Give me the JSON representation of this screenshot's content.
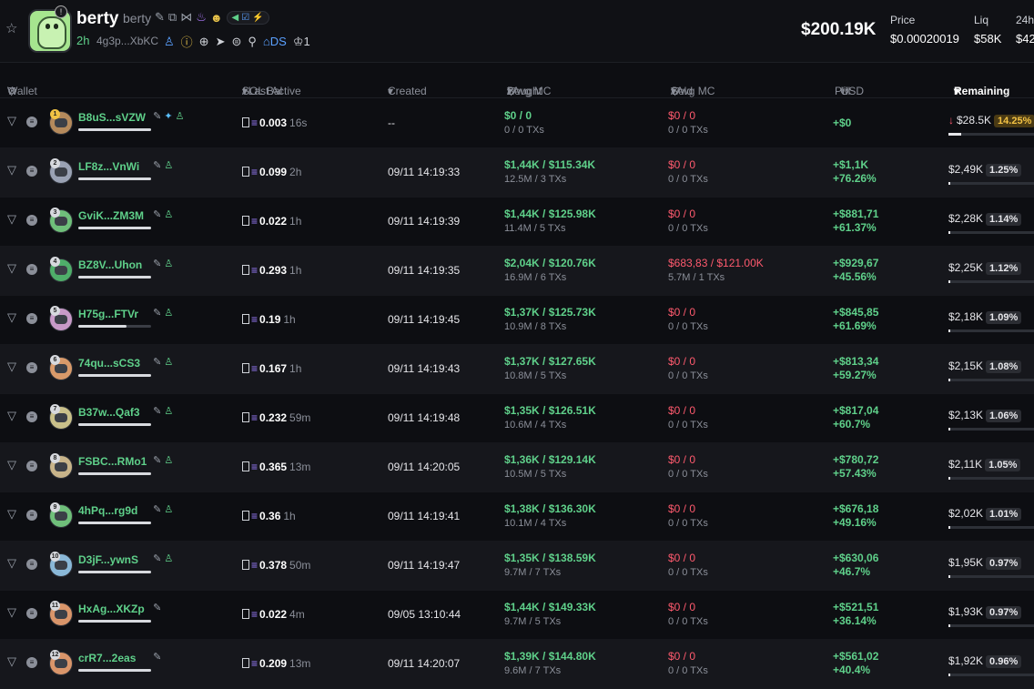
{
  "header": {
    "token_name": "berty",
    "token_symbol": "berty",
    "age": "2h",
    "address": "4g3p...XbKC",
    "market_cap": "$200.19K",
    "stats": [
      {
        "label": "Price",
        "value": "$0.00020019"
      },
      {
        "label": "Liq",
        "value": "$58K"
      },
      {
        "label": "24h",
        "value": "$42"
      }
    ],
    "ds_label": "DS",
    "holders_count": "1"
  },
  "columns": {
    "wallet": "Wallet",
    "sol_bal": "SOL Bal",
    "last_active": "/ Last Active",
    "created": "Created",
    "bought": "Bought",
    "avg_mc_bought": "/ Avg MC",
    "sold": "Sold",
    "avg_mc_sold": "/ Avg MC",
    "pnl": "Pnl",
    "usd": "USD",
    "remaining": "Remaining"
  },
  "rows": [
    {
      "rank": "1",
      "wallet": "B8uS...sVZW",
      "sol": "0.003",
      "ago": "16s",
      "created": "--",
      "bought": "$0 / 0",
      "bought_sub": "0 / 0 TXs",
      "sold": "$0 / 0",
      "sold_sub": "0 / 0 TXs",
      "pnl": "+$0",
      "pnl_pct": "",
      "remaining": "$28.5K",
      "rem_pct": "14.25%",
      "rem_down": "↓",
      "bar": 0.15,
      "color": "#b58a5c"
    },
    {
      "rank": "2",
      "wallet": "LF8z...VnWi",
      "sol": "0.099",
      "ago": "2h",
      "created": "09/11 14:19:33",
      "bought": "$1,44K / $115.34K",
      "bought_sub": "12.5M / 3 TXs",
      "sold": "$0 / 0",
      "sold_sub": "0 / 0 TXs",
      "pnl": "+$1,1K",
      "pnl_pct": "+76.26%",
      "remaining": "$2,49K",
      "rem_pct": "1.25%",
      "rem_down": "",
      "bar": 0.02,
      "color": "#9aa2b4"
    },
    {
      "rank": "3",
      "wallet": "GviK...ZM3M",
      "sol": "0.022",
      "ago": "1h",
      "created": "09/11 14:19:39",
      "bought": "$1,44K / $125.98K",
      "bought_sub": "11.4M / 5 TXs",
      "sold": "$0 / 0",
      "sold_sub": "0 / 0 TXs",
      "pnl": "+$881,71",
      "pnl_pct": "+61.37%",
      "remaining": "$2,28K",
      "rem_pct": "1.14%",
      "rem_down": "",
      "bar": 0.02,
      "color": "#6fbf7a"
    },
    {
      "rank": "4",
      "wallet": "BZ8V...Uhon",
      "sol": "0.293",
      "ago": "1h",
      "created": "09/11 14:19:35",
      "bought": "$2,04K / $120.76K",
      "bought_sub": "16.9M / 6 TXs",
      "sold": "$683,83 / $121.00K",
      "sold_sub": "5.7M / 1 TXs",
      "pnl": "+$929,67",
      "pnl_pct": "+45.56%",
      "remaining": "$2,25K",
      "rem_pct": "1.12%",
      "rem_down": "",
      "bar": 0.02,
      "color": "#4fae6a"
    },
    {
      "rank": "5",
      "wallet": "H75g...FTVr",
      "sol": "0.19",
      "ago": "1h",
      "created": "09/11 14:19:45",
      "bought": "$1,37K / $125.73K",
      "bought_sub": "10.9M / 8 TXs",
      "sold": "$0 / 0",
      "sold_sub": "0 / 0 TXs",
      "pnl": "+$845,85",
      "pnl_pct": "+61.69%",
      "remaining": "$2,18K",
      "rem_pct": "1.09%",
      "rem_down": "",
      "bar": 0.02,
      "color": "#c89ac8"
    },
    {
      "rank": "6",
      "wallet": "74qu...sCS3",
      "sol": "0.167",
      "ago": "1h",
      "created": "09/11 14:19:43",
      "bought": "$1,37K / $127.65K",
      "bought_sub": "10.8M / 5 TXs",
      "sold": "$0 / 0",
      "sold_sub": "0 / 0 TXs",
      "pnl": "+$813,34",
      "pnl_pct": "+59.27%",
      "remaining": "$2,15K",
      "rem_pct": "1.08%",
      "rem_down": "",
      "bar": 0.02,
      "color": "#d99a6a"
    },
    {
      "rank": "7",
      "wallet": "B37w...Qaf3",
      "sol": "0.232",
      "ago": "59m",
      "created": "09/11 14:19:48",
      "bought": "$1,35K / $126.51K",
      "bought_sub": "10.6M / 4 TXs",
      "sold": "$0 / 0",
      "sold_sub": "0 / 0 TXs",
      "pnl": "+$817,04",
      "pnl_pct": "+60.7%",
      "remaining": "$2,13K",
      "rem_pct": "1.06%",
      "rem_down": "",
      "bar": 0.02,
      "color": "#c9c08a"
    },
    {
      "rank": "8",
      "wallet": "FSBC...RMo1",
      "sol": "0.365",
      "ago": "13m",
      "created": "09/11 14:20:05",
      "bought": "$1,36K / $129.14K",
      "bought_sub": "10.5M / 5 TXs",
      "sold": "$0 / 0",
      "sold_sub": "0 / 0 TXs",
      "pnl": "+$780,72",
      "pnl_pct": "+57.43%",
      "remaining": "$2,11K",
      "rem_pct": "1.05%",
      "rem_down": "",
      "bar": 0.02,
      "color": "#c8b48a"
    },
    {
      "rank": "9",
      "wallet": "4hPq...rg9d",
      "sol": "0.36",
      "ago": "1h",
      "created": "09/11 14:19:41",
      "bought": "$1,38K / $136.30K",
      "bought_sub": "10.1M / 4 TXs",
      "sold": "$0 / 0",
      "sold_sub": "0 / 0 TXs",
      "pnl": "+$676,18",
      "pnl_pct": "+49.16%",
      "remaining": "$2,02K",
      "rem_pct": "1.01%",
      "rem_down": "",
      "bar": 0.02,
      "color": "#6fbf7a"
    },
    {
      "rank": "10",
      "wallet": "D3jF...ywnS",
      "sol": "0.378",
      "ago": "50m",
      "created": "09/11 14:19:47",
      "bought": "$1,35K / $138.59K",
      "bought_sub": "9.7M / 7 TXs",
      "sold": "$0 / 0",
      "sold_sub": "0 / 0 TXs",
      "pnl": "+$630,06",
      "pnl_pct": "+46.7%",
      "remaining": "$1,95K",
      "rem_pct": "0.97%",
      "rem_down": "",
      "bar": 0.02,
      "color": "#8ab8d8"
    },
    {
      "rank": "11",
      "wallet": "HxAg...XKZp",
      "sol": "0.022",
      "ago": "4m",
      "created": "09/05 13:10:44",
      "bought": "$1,44K / $149.33K",
      "bought_sub": "9.7M / 5 TXs",
      "sold": "$0 / 0",
      "sold_sub": "0 / 0 TXs",
      "pnl": "+$521,51",
      "pnl_pct": "+36.14%",
      "remaining": "$1,93K",
      "rem_pct": "0.97%",
      "rem_down": "",
      "bar": 0.02,
      "color": "#d9956a"
    },
    {
      "rank": "12",
      "wallet": "crR7...2eas",
      "sol": "0.209",
      "ago": "13m",
      "created": "09/11 14:20:07",
      "bought": "$1,39K / $144.80K",
      "bought_sub": "9.6M / 7 TXs",
      "sold": "$0 / 0",
      "sold_sub": "0 / 0 TXs",
      "pnl": "+$561,02",
      "pnl_pct": "+40.4%",
      "remaining": "$1,92K",
      "rem_pct": "0.96%",
      "rem_down": "",
      "bar": 0.02,
      "color": "#d9956a"
    }
  ]
}
